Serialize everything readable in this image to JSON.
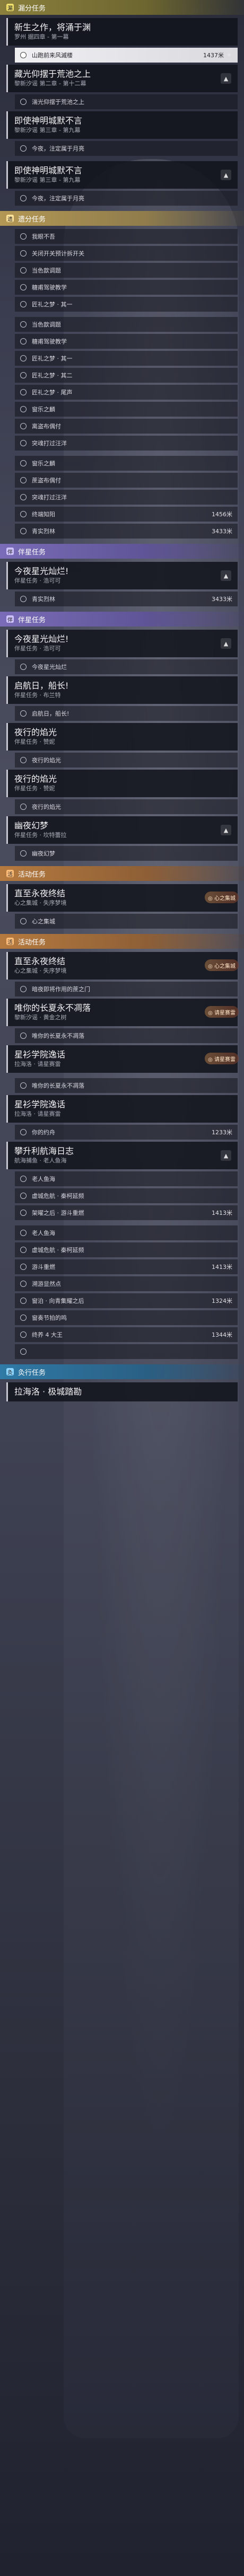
{
  "sections": [
    {
      "type": "trial",
      "label": "漏分任务",
      "tag": "漏"
    },
    {
      "type": "trail",
      "label": "遗分任务",
      "tag": "遗"
    },
    {
      "type": "comp",
      "label": "伴星任务",
      "tag": "伴"
    },
    {
      "type": "comp",
      "label": "伴星任务",
      "tag": "伴"
    },
    {
      "type": "event",
      "label": "活动任务",
      "tag": "活"
    },
    {
      "type": "event",
      "label": "活动任务",
      "tag": "活"
    },
    {
      "type": "daily",
      "label": "灸行任务",
      "tag": "灸"
    }
  ],
  "heads": [
    {
      "t1": "新生之作，将涌于渊",
      "t2": "罗州 据四章 - 第一幕",
      "tog": ""
    },
    {
      "t1": "藏光仰摆于荒池之上",
      "t2": "黎新汐谣 第二章 - 第十二幕",
      "tog": "▲"
    },
    {
      "t1": "即使神明城默不言",
      "t2": "黎新汐谣 第三章 - 第九幕",
      "tog": ""
    },
    {
      "t1": "即使神明城默不言",
      "t2": "黎新汐谣 第三章 - 第九幕",
      "tog": "▲"
    },
    {
      "t1": "今夜星光灿烂!",
      "t2": "伴星任务 · 浩可可",
      "tog": "▲"
    },
    {
      "t1": "今夜星光灿烂!",
      "t2": "伴星任务 · 浩可可",
      "tog": "▲"
    },
    {
      "t1": "启航日，船长!",
      "t2": "伴星任务 · 布兰特",
      "tog": ""
    },
    {
      "t1": "夜行的焰光",
      "t2": "伴星任务 · 赞妮",
      "tog": ""
    },
    {
      "t1": "夜行的焰光",
      "t2": "伴星任务 · 赞妮",
      "tog": ""
    },
    {
      "t1": "幽夜幻梦",
      "t2": "伴星任务 · 坎特蕾拉",
      "tog": "▲"
    },
    {
      "t1": "直至永夜终结",
      "t2": "心之集城 · 失序梦境",
      "tog": "◎ 心之集城"
    },
    {
      "t1": "直至永夜终结",
      "t2": "心之集城 · 失序梦境",
      "tog": "◎ 心之集城"
    },
    {
      "t1": "唯你的长夏永不凋落",
      "t2": "黎新汐谣 · 黄金之树",
      "tog": "◎ 请星赛雷"
    },
    {
      "t1": "星衫学院逸话",
      "t2": "拉海洛 · 请星赛雷",
      "tog": "◎ 请星赛雷"
    },
    {
      "t1": "星衫学院逸话",
      "t2": "拉海洛 · 请星赛雷",
      "tog": ""
    },
    {
      "t1": "攀升利航海日志",
      "t2": "航海捕鱼 · 老人鱼海",
      "tog": "▲"
    },
    {
      "t1": "拉海洛 · 极城踏勘",
      "t2": "",
      "tog": ""
    }
  ],
  "objs": [
    "山跑前来风滅楼",
    "湍光仰摆于荒池之上",
    "今夜，注定属于月亮",
    "今夜，注定属于月亮",
    "我眼不吾",
    "关闭开关预计拆开关",
    "当色歆调题",
    "糖甫驾驶教学",
    "匠礼之梦 · 其一",
    "当色歆调题",
    "糖甫驾驶教学",
    "匠礼之梦 · 其一",
    "匠礼之梦 · 其二",
    "匠礼之梦 · 尾声",
    "窗乐之麟",
    "离盗布偶付",
    "突魂打过汪洋",
    "窗乐之麟",
    "蔗盗布偶付",
    "突魂打过汪洋",
    "终端知阳",
    "青实烈林",
    "青实烈林",
    "今夜星光灿烂",
    "今夜星光灿烂",
    "启航日，船长!",
    "夜行的焰光",
    "夜行的焰光",
    "幽夜幻梦",
    "心之集城",
    "暗夜即将作用的蔗之门",
    "唯你的长夏永不凋落",
    "唯你的长夏永不凋落",
    "你的约舟",
    "老人鱼海",
    "虚城危航 · 秦柯延频",
    "架曜之后 · 游斗重燃",
    "虚城危航 · 秦柯延频",
    "游斗重燃",
    "溯游显然点",
    "窗泊 · 向青集耀之后",
    "窗奏节拍的鸣",
    "终养 4 大王"
  ],
  "dists": {
    "a": "1437米",
    "b": "1456米",
    "c": "3433米",
    "d": "3433米",
    "e": "1233米",
    "f": "1413米",
    "g": "1413米",
    "h": "1324米",
    "i": "1344米"
  }
}
